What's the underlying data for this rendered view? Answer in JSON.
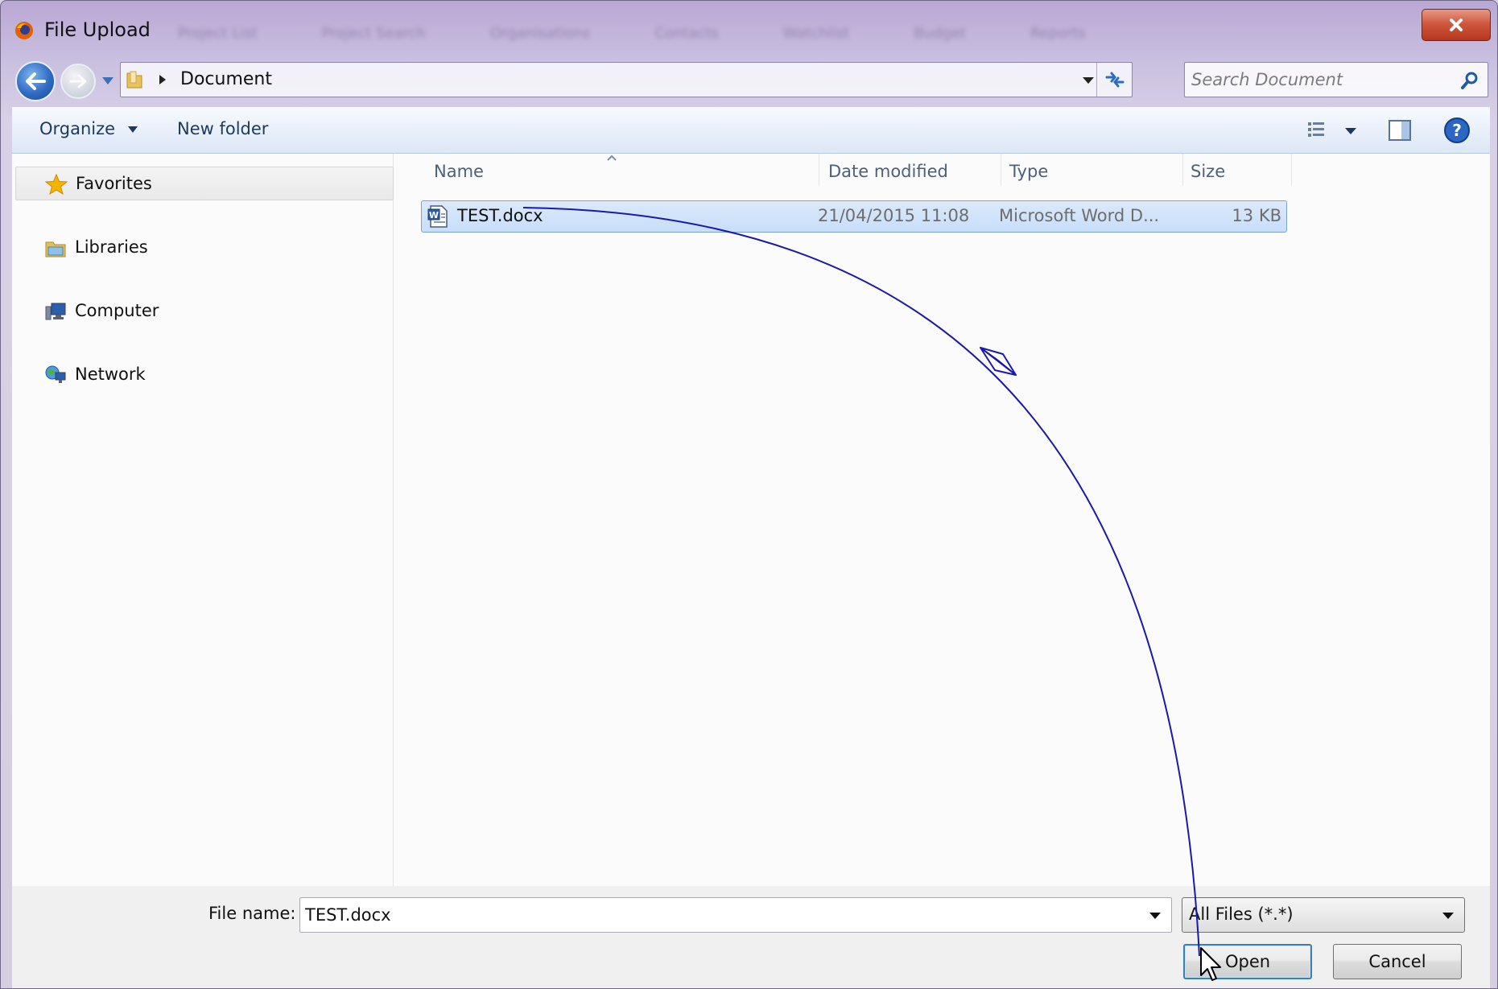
{
  "window": {
    "title": "File Upload",
    "background_tabs": [
      "Project List",
      "Project Search",
      "Organisations",
      "Contacts",
      "Watchlist",
      "Budget",
      "Reports"
    ]
  },
  "address": {
    "path": [
      "Document"
    ],
    "search_placeholder": "Search Document"
  },
  "toolbar": {
    "organize_label": "Organize",
    "new_folder_label": "New folder"
  },
  "sidebar": {
    "items": [
      {
        "label": "Favorites",
        "icon": "star-icon",
        "selected": true
      },
      {
        "label": "Libraries",
        "icon": "libraries-icon",
        "selected": false
      },
      {
        "label": "Computer",
        "icon": "computer-icon",
        "selected": false
      },
      {
        "label": "Network",
        "icon": "network-icon",
        "selected": false
      }
    ]
  },
  "file_list": {
    "columns": [
      "Name",
      "Date modified",
      "Type",
      "Size"
    ],
    "rows": [
      {
        "name": "TEST.docx",
        "date_modified": "21/04/2015 11:08",
        "type": "Microsoft Word D...",
        "size": "13 KB",
        "selected": true
      }
    ]
  },
  "footer": {
    "file_name_label": "File name:",
    "file_name_value": "TEST.docx",
    "filter_value": "All Files (*.*)",
    "open_label": "Open",
    "cancel_label": "Cancel"
  },
  "colors": {
    "accent_blue": "#2f6cc4",
    "annotation_line": "#1a1aa8",
    "close_red": "#c9452c",
    "selection_fill": "#cfe2fb"
  }
}
